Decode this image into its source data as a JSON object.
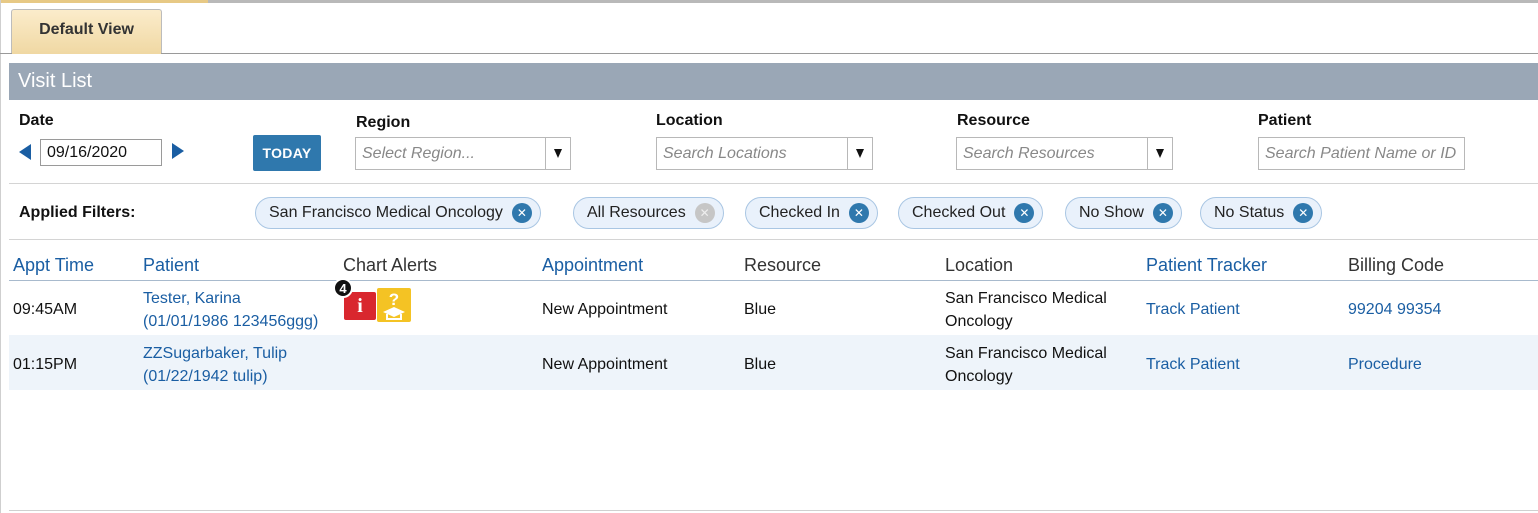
{
  "tab": {
    "label": "Default View"
  },
  "header": {
    "title": "Visit List"
  },
  "filters": {
    "date": {
      "label": "Date",
      "value": "09/16/2020",
      "today_label": "TODAY"
    },
    "region": {
      "label": "Region",
      "placeholder": "Select Region..."
    },
    "location": {
      "label": "Location",
      "placeholder": "Search Locations"
    },
    "resource": {
      "label": "Resource",
      "placeholder": "Search Resources"
    },
    "patient": {
      "label": "Patient",
      "placeholder": "Search Patient Name or ID"
    }
  },
  "applied": {
    "label": "Applied Filters:",
    "chips": [
      {
        "label": "San Francisco Medical Oncology",
        "removable": true
      },
      {
        "label": "All Resources",
        "removable": false
      },
      {
        "label": "Checked In",
        "removable": true
      },
      {
        "label": "Checked Out",
        "removable": true
      },
      {
        "label": "No Show",
        "removable": true
      },
      {
        "label": "No Status",
        "removable": true
      }
    ],
    "remove_glyph": "✕"
  },
  "table": {
    "columns": [
      "Appt Time",
      "Patient",
      "Chart Alerts",
      "Appointment",
      "Resource",
      "Location",
      "Patient Tracker",
      "Billing Code"
    ],
    "rows": [
      {
        "time": "09:45AM",
        "patient_name": "Tester, Karina",
        "patient_detail": "(01/01/1986 123456ggg)",
        "alerts": {
          "count": "4",
          "info_glyph": "i",
          "icons": [
            "info-alert-icon",
            "education-alert-icon"
          ]
        },
        "appointment": "New Appointment",
        "resource": "Blue",
        "location_line1": "San Francisco Medical",
        "location_line2": "Oncology",
        "tracker": "Track Patient",
        "billing": "99204 99354"
      },
      {
        "time": "01:15PM",
        "patient_name": "ZZSugarbaker, Tulip",
        "patient_detail": "(01/22/1942 tulip)",
        "appointment": "New Appointment",
        "resource": "Blue",
        "location_line1": "San Francisco Medical",
        "location_line2": "Oncology",
        "tracker": "Track Patient",
        "billing": "Procedure"
      }
    ]
  },
  "colors": {
    "header_bar": "#9aa7b6",
    "link": "#1a5ea3",
    "today_button": "#2f78ad",
    "alert_red": "#d9272e",
    "alert_yellow": "#f4c324",
    "row_alt": "#eef4fa"
  }
}
